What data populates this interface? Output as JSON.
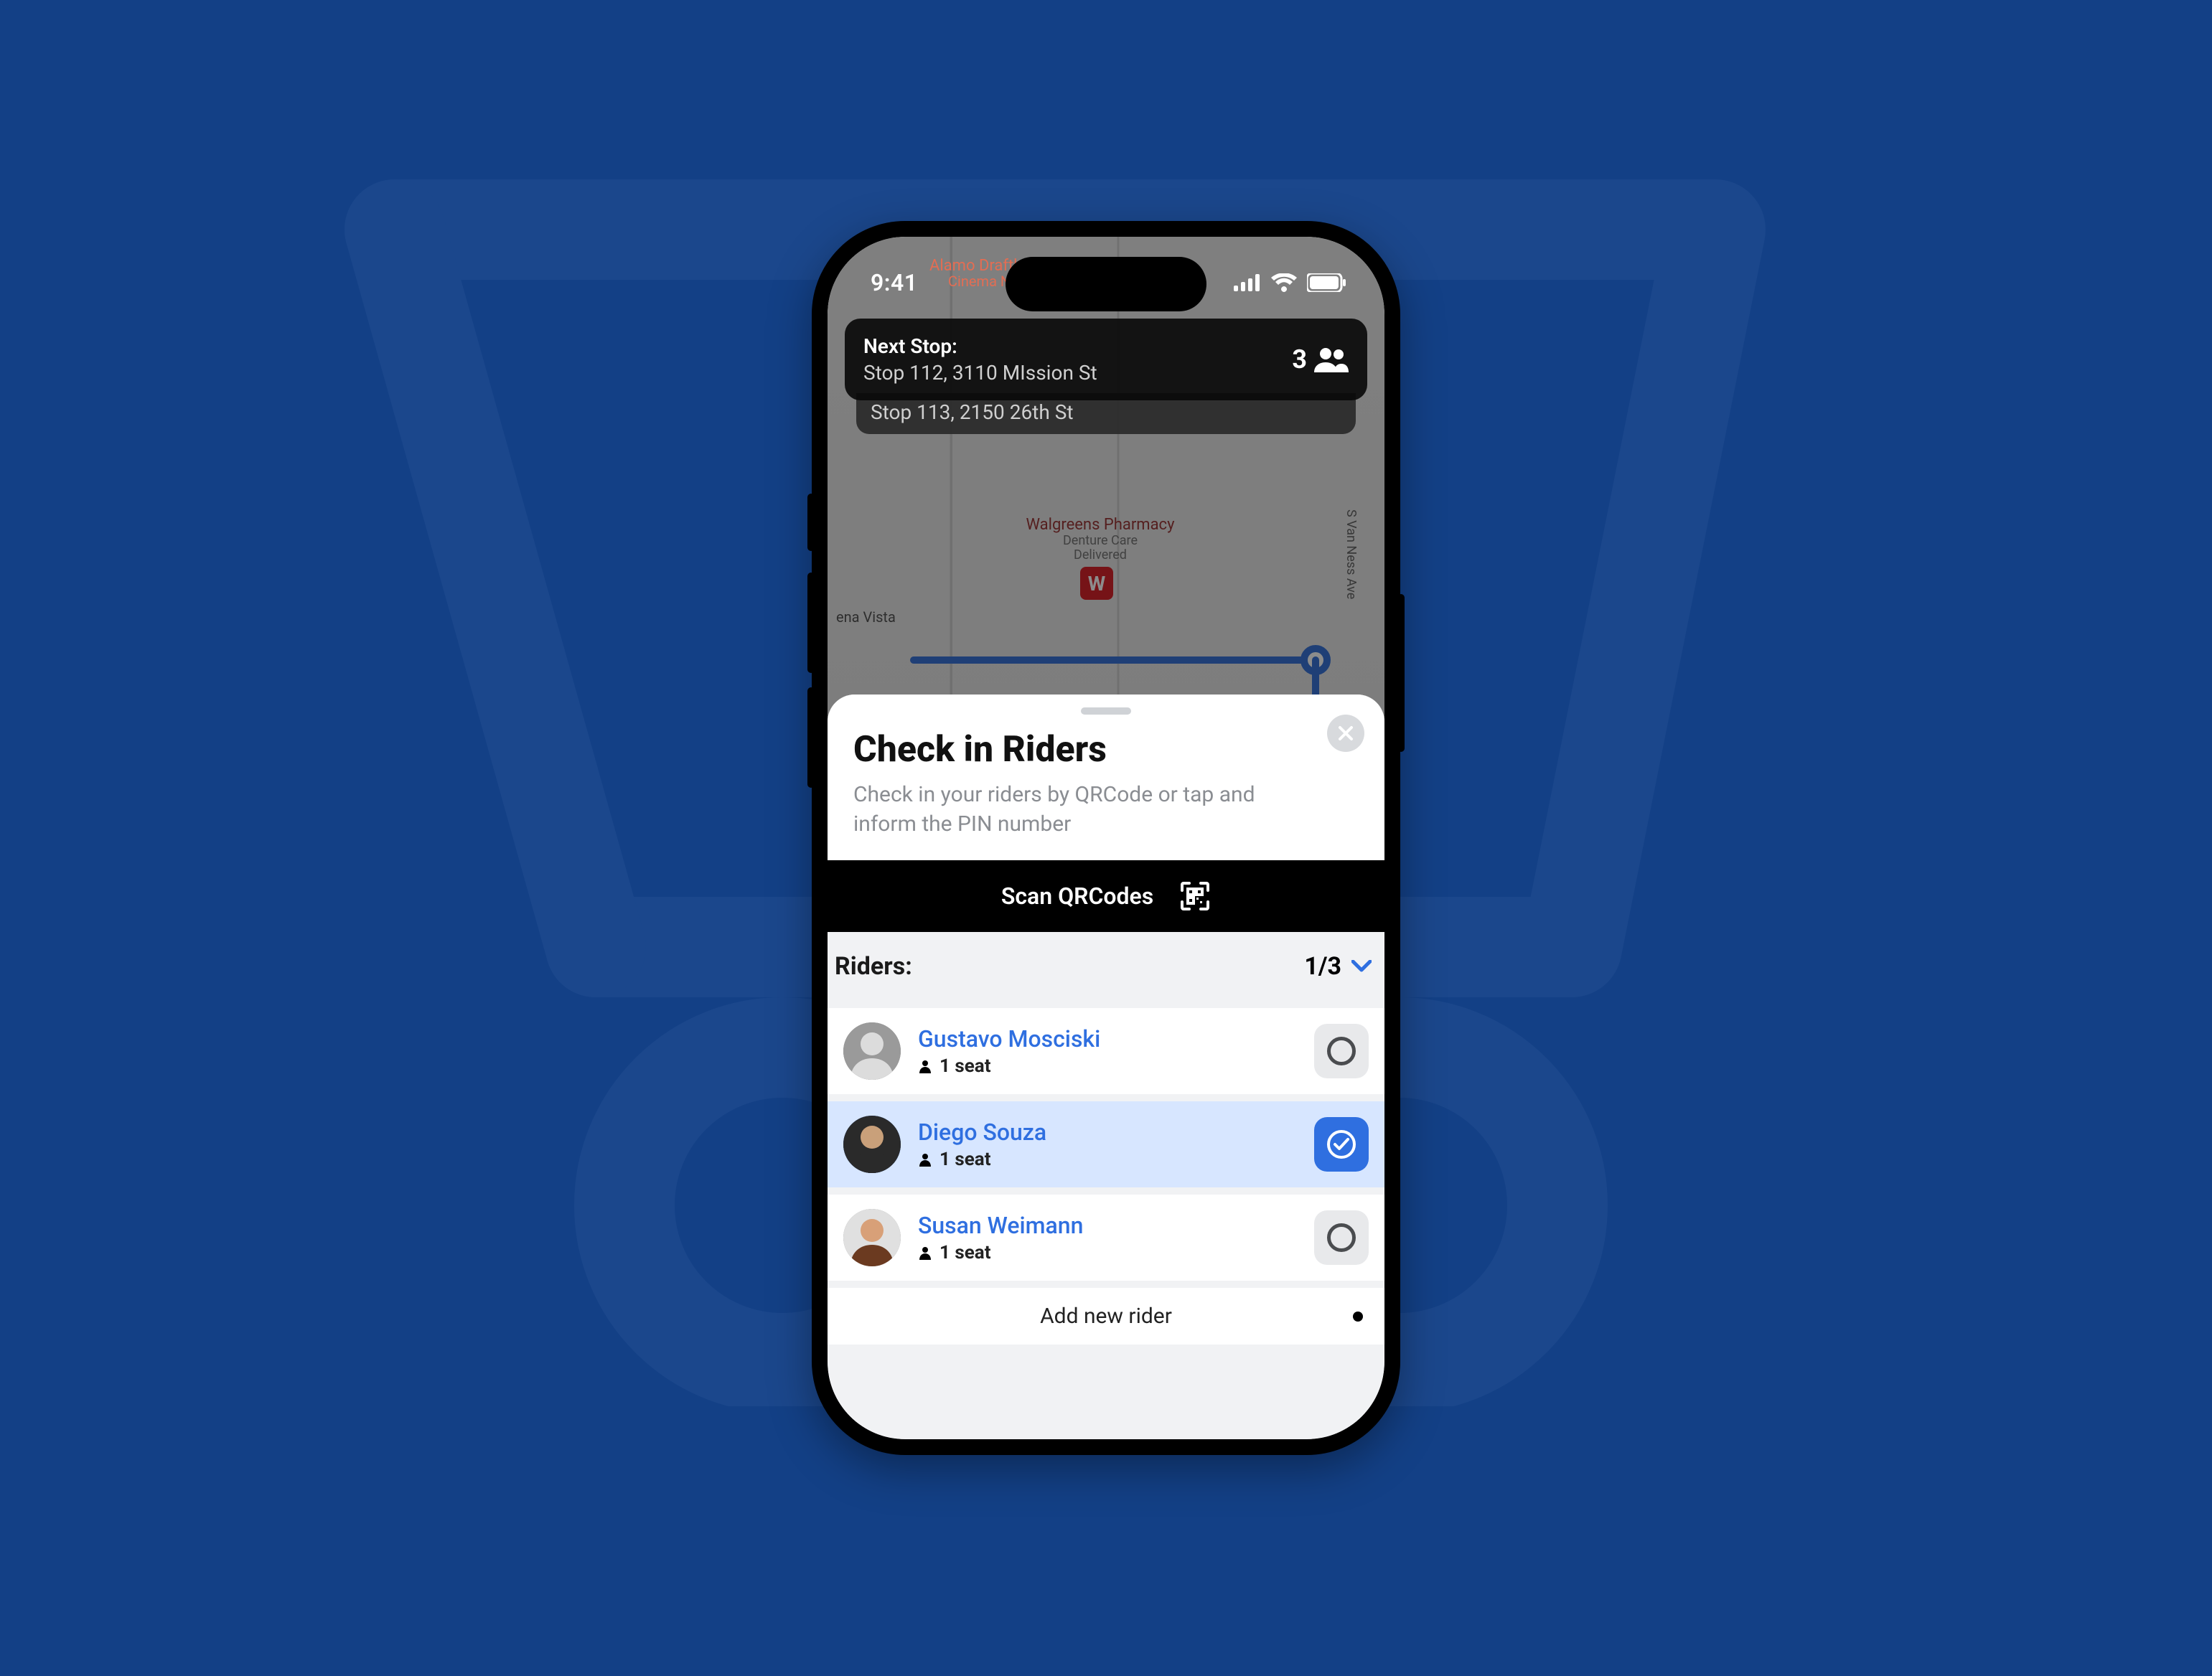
{
  "status": {
    "time": "9:41"
  },
  "bg_map": {
    "alamo_line1": "Alamo Draftho",
    "alamo_line2": "Cinema New Miss",
    "walgreens_line1": "Walgreens Pharmacy",
    "walgreens_line2": "Denture Care",
    "walgreens_line3": "Delivered",
    "walgreens_badge": "W",
    "ave": "S Van Ness Ave",
    "ena_vista": "ena Vista"
  },
  "next_stop": {
    "label": "Next Stop:",
    "line": "Stop 112, 3110 MIssion St",
    "pax_count": "3",
    "following": "Stop 113, 2150 26th St"
  },
  "sheet": {
    "title": "Check in Riders",
    "subtitle": "Check in your riders by QRCode or tap and inform the PIN number",
    "scan_label": "Scan QRCodes",
    "riders_label": "Riders:",
    "riders_count": "1/3",
    "add_new": "Add new rider"
  },
  "riders": [
    {
      "name": "Gustavo Mosciski",
      "seats": "1 seat",
      "checked": false
    },
    {
      "name": "Diego Souza",
      "seats": "1 seat",
      "checked": true
    },
    {
      "name": "Susan Weimann",
      "seats": "1 seat",
      "checked": false
    }
  ]
}
